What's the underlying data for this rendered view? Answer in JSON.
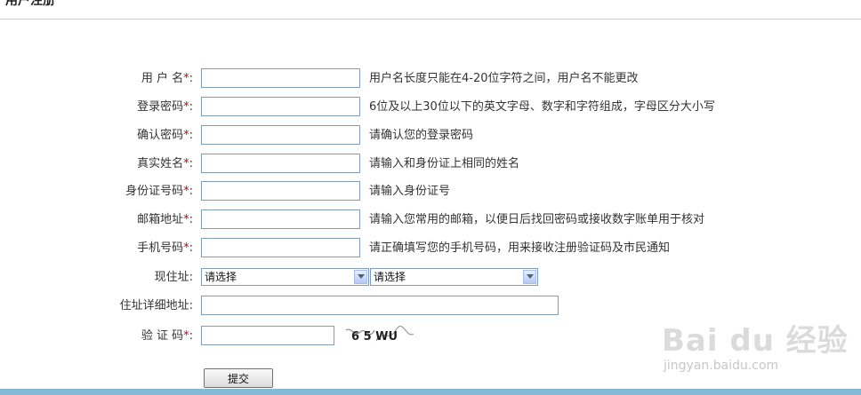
{
  "page_title": "用户注册",
  "form": {
    "username": {
      "label": "用 户 名",
      "required": "*",
      "hint": "用户名长度只能在4-20位字符之间，用户名不能更改"
    },
    "password": {
      "label": "登录密码",
      "required": "*",
      "hint": "6位及以上30位以下的英文字母、数字和字符组成，字母区分大小写"
    },
    "confirm_password": {
      "label": "确认密码",
      "required": "*",
      "hint": "请确认您的登录密码"
    },
    "real_name": {
      "label": "真实姓名",
      "required": "*",
      "hint": "请输入和身份证上相同的姓名"
    },
    "id_number": {
      "label": "身份证号码",
      "required": "*",
      "hint": "请输入身份证号"
    },
    "email": {
      "label": "邮箱地址",
      "required": "*",
      "hint": "请输入您常用的邮箱，以便日后找回密码或接收数字账单用于核对"
    },
    "phone": {
      "label": "手机号码",
      "required": "*",
      "hint": "请正确填写您的手机号码，用来接收注册验证码及市民通知"
    },
    "address": {
      "label": "现住址:",
      "select1": "请选择",
      "select2": "请选择"
    },
    "address_detail": {
      "label": "住址详细地址:"
    },
    "captcha": {
      "label": "验 证 码",
      "required": "*",
      "image_text": "6 5 WU"
    },
    "submit_label": "提交"
  },
  "watermark": {
    "logo": "Bai du 经验",
    "url": "jingyan.baidu.com"
  },
  "colors": {
    "required_star": "#cc0000",
    "input_border": "#7f9db9",
    "bottom_bar": "#86b9d6"
  }
}
